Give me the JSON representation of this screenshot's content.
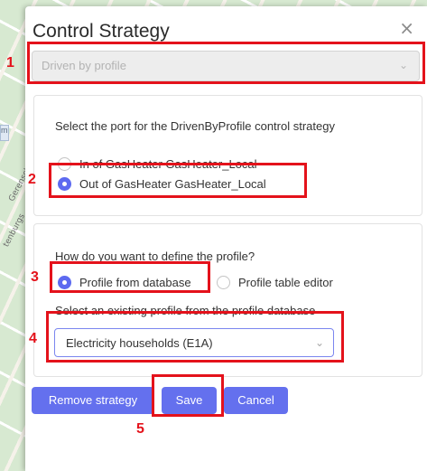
{
  "dialog": {
    "title": "Control Strategy",
    "close_glyph": "×",
    "strategy_select": {
      "value": "Driven by profile",
      "chevron_glyph": "⌄"
    }
  },
  "port_section": {
    "prompt": "Select the port for the DrivenByProfile control strategy",
    "options": [
      {
        "label": "In of GasHeater GasHeater_Local",
        "selected": false
      },
      {
        "label": "Out of GasHeater GasHeater_Local",
        "selected": true
      }
    ]
  },
  "profile_section": {
    "prompt": "How do you want to define the profile?",
    "options": [
      {
        "label": "Profile from database",
        "selected": true
      },
      {
        "label": "Profile table editor",
        "selected": false
      }
    ],
    "db_prompt": "Select an existing profile from the profile database",
    "profile_select": {
      "value": "Electricity households (E1A)",
      "chevron_glyph": "⌄"
    }
  },
  "buttons": {
    "remove": "Remove strategy",
    "save": "Save",
    "cancel": "Cancel"
  },
  "annotations": [
    "1",
    "2",
    "3",
    "4",
    "5"
  ],
  "map_texts": [
    "Gerensche",
    "tenburgs"
  ],
  "colors": {
    "accent": "#6470ee",
    "annotation": "#e4121b",
    "disabled_select_bg": "#ededed"
  }
}
